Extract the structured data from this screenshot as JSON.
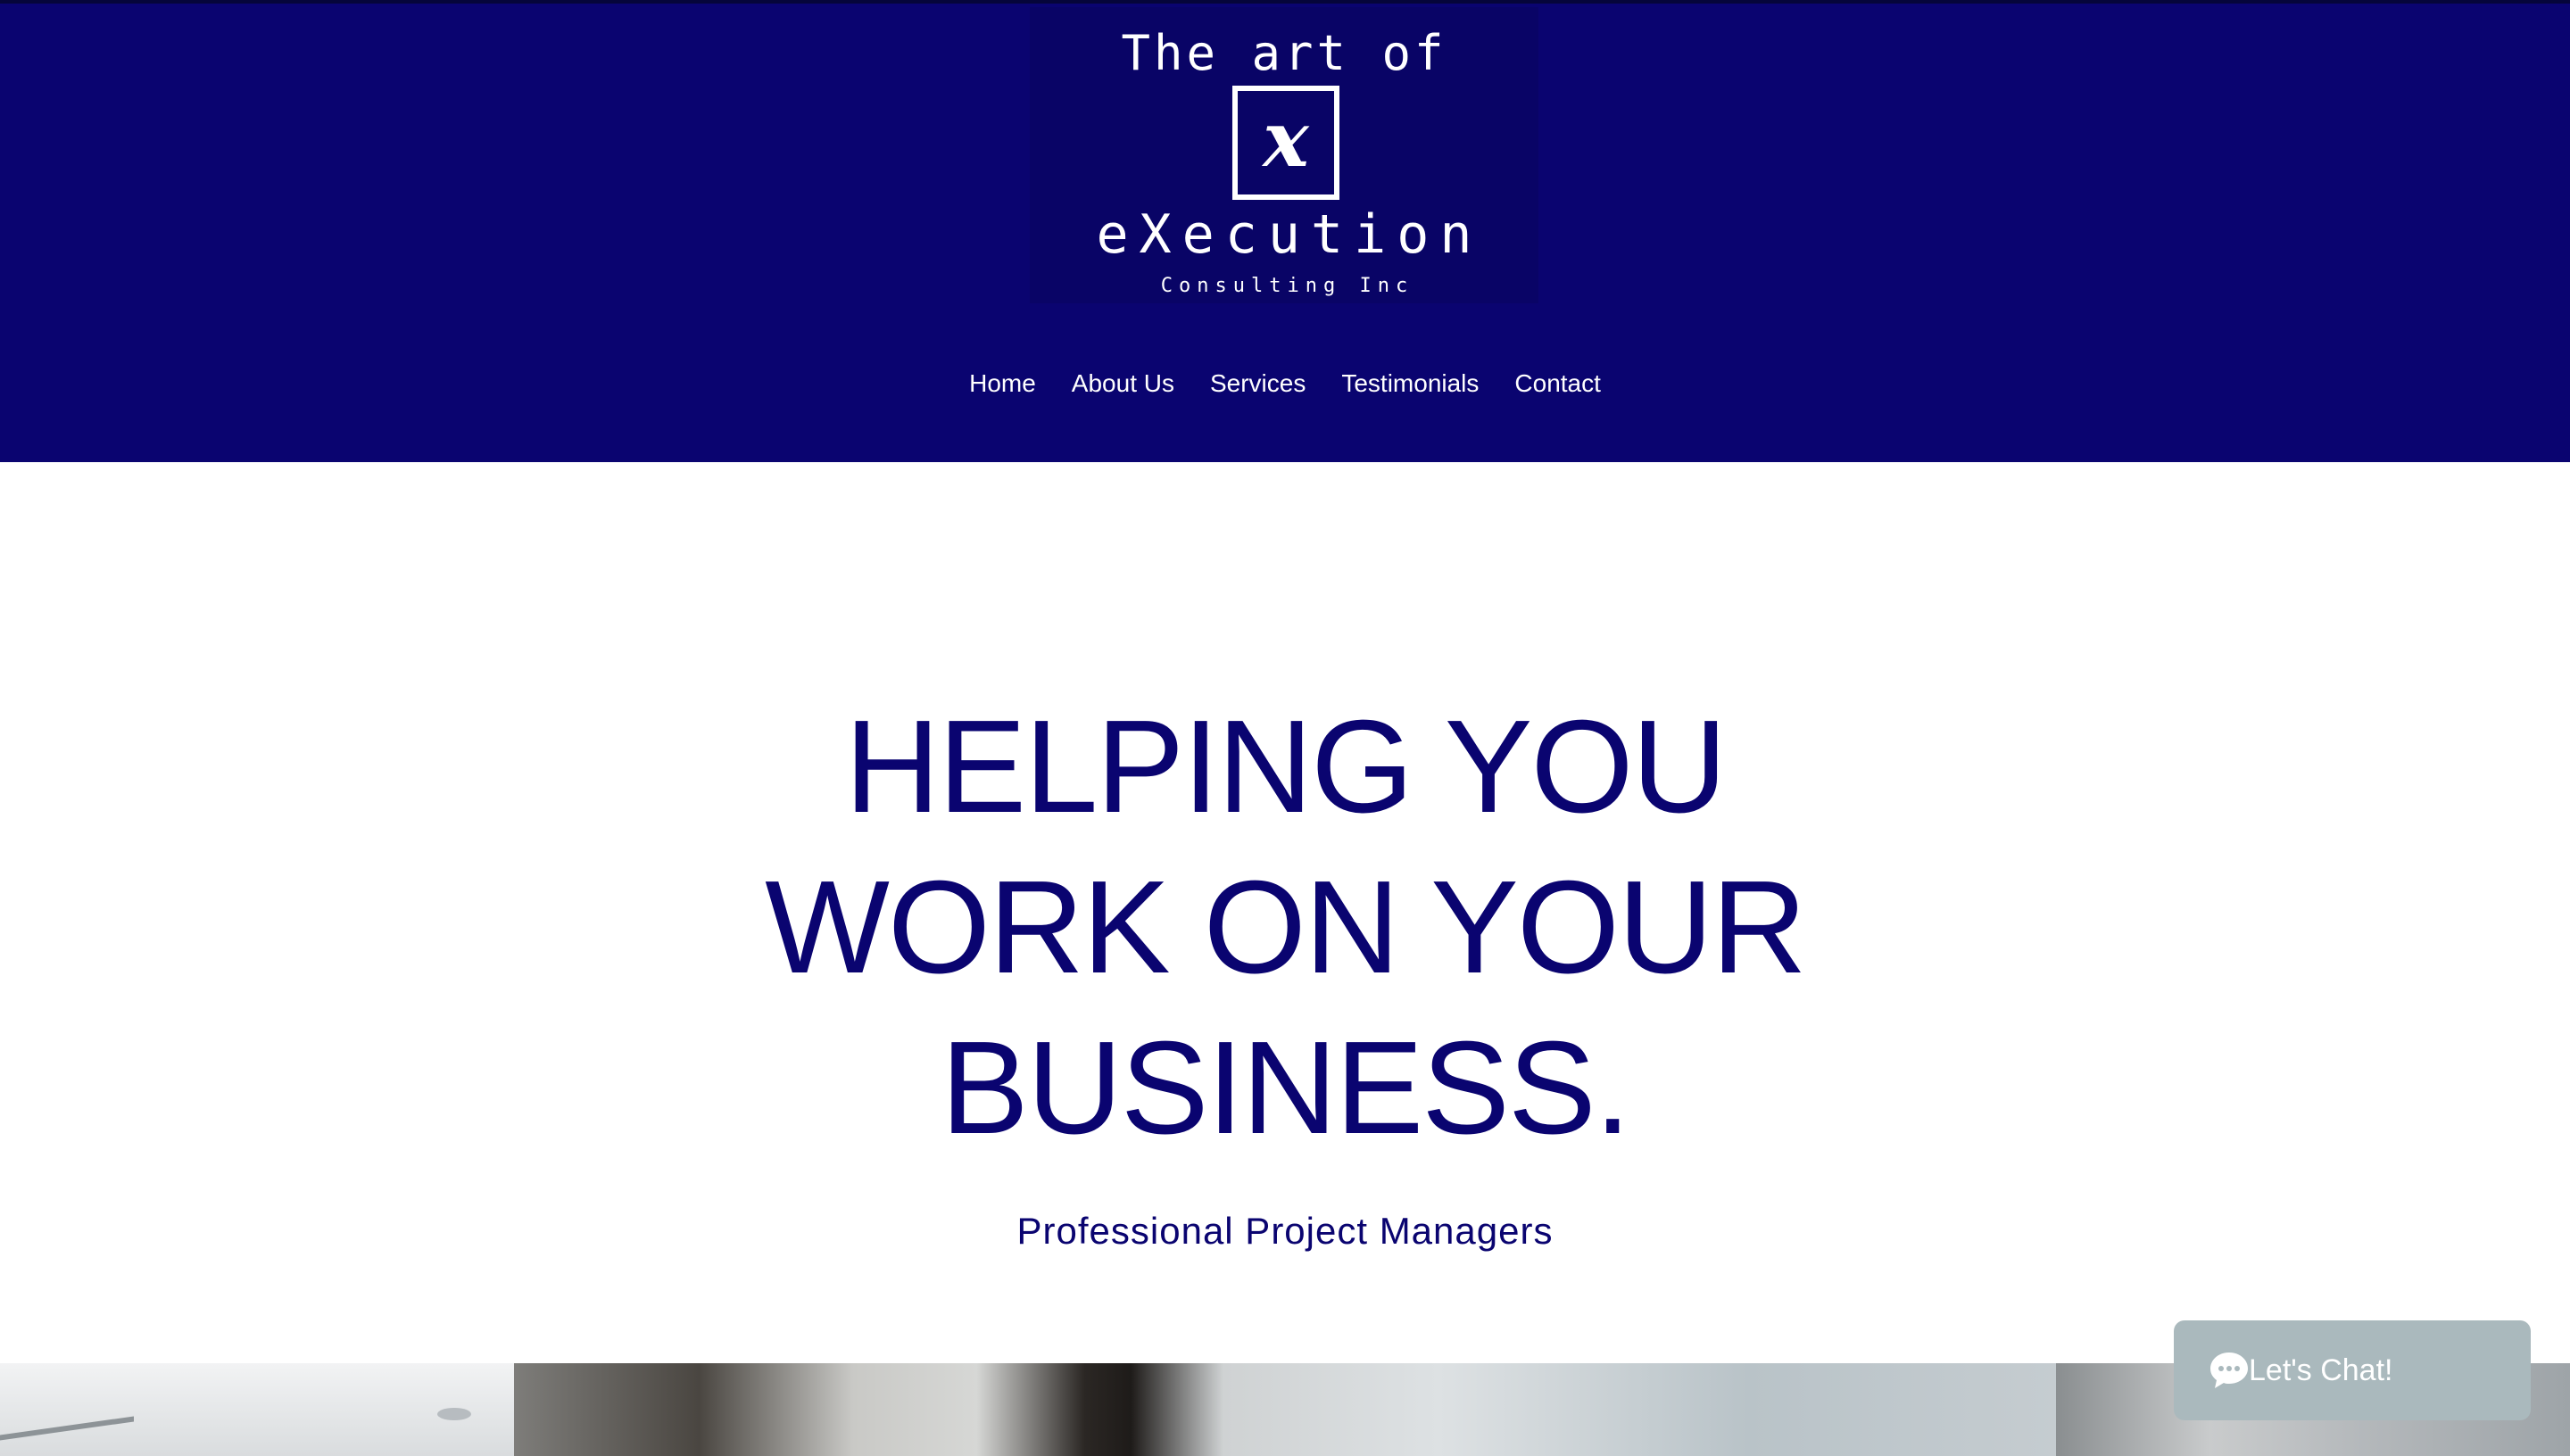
{
  "logo": {
    "line1": "The art of",
    "mark": "x",
    "line2": "eXecution",
    "line3": "Consulting Inc"
  },
  "nav": {
    "items": [
      "Home",
      "About Us",
      "Services",
      "Testimonials",
      "Contact"
    ]
  },
  "hero": {
    "title_line1": "HELPING YOU",
    "title_line2": "WORK ON YOUR",
    "title_line3": "BUSINESS.",
    "subtitle": "Professional Project Managers"
  },
  "chat": {
    "label": "Let's Chat!",
    "icon": "chat-bubble-icon"
  },
  "colors": {
    "brand_navy": "#0a0470",
    "chat_bg": "#aab9bd"
  }
}
